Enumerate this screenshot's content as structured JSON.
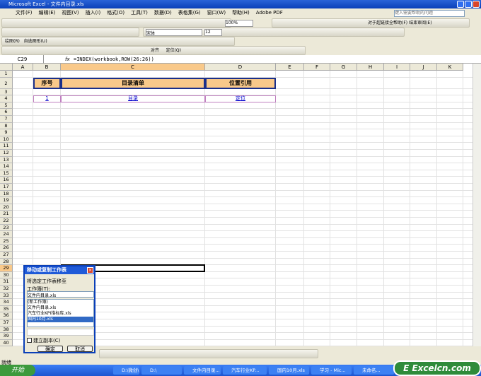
{
  "window": {
    "title": "Microsoft Excel - 文件内目录.xls"
  },
  "menu": [
    "文件(F)",
    "编辑(E)",
    "视图(V)",
    "插入(I)",
    "格式(O)",
    "工具(T)",
    "数据(D)",
    "表格集(G)",
    "窗口(W)",
    "帮助(H)",
    "Adobe PDF"
  ],
  "help_placeholder": "键入需要帮助的问题",
  "toolbar": {
    "zoom": "100%",
    "font": "宋体",
    "font_size": "12",
    "plugin1": "对于超链接全帮助(F)",
    "plugin2": "结束审阅(E)",
    "draw": "绘图(R)",
    "autoshape": "自选图形(U)",
    "align": "对齐",
    "position": "定位(Q)"
  },
  "formula_bar": {
    "name_box": "C29",
    "fx": "fx",
    "formula": "=INDEX(workbook,ROW(26:26))"
  },
  "columns": [
    "A",
    "B",
    "C",
    "D",
    "E",
    "F",
    "G",
    "H",
    "I",
    "J",
    "K"
  ],
  "table": {
    "headers": [
      "序号",
      "目录清单",
      "位置引用"
    ],
    "row": [
      "1",
      "目录",
      "定位"
    ]
  },
  "dialog": {
    "title": "移动或复制工作表",
    "prompt": "将选定工作表移至",
    "workbook_label": "工作簿(T):",
    "workbook_value": "文件内目录.xls",
    "list": [
      "(新工作簿)",
      "文件内目录.xls",
      "汽车行业KPI指标库.xls",
      "国内10月.xls"
    ],
    "selected": 3,
    "copy_label": "建立副本(C)",
    "ok": "确定",
    "cancel": "取消"
  },
  "status": "就绪",
  "taskbar": {
    "start": "开始",
    "items": [
      "D:\\微创\\1-...",
      "D:\\",
      "文件内目录...",
      "汽车行业KP...",
      "国内10月.xls",
      "学习 - Mic...",
      "未命名..."
    ]
  },
  "watermark": "Excelcn.com"
}
